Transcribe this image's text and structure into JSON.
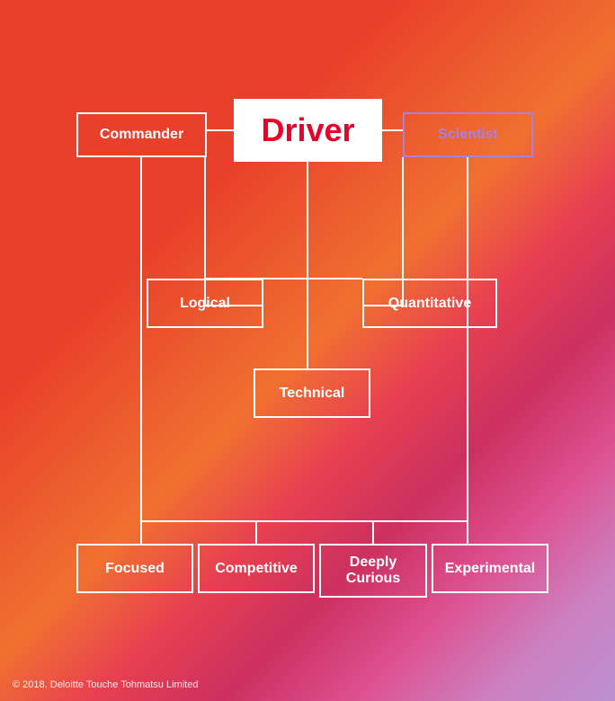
{
  "title": "Driver",
  "nodes": {
    "driver": {
      "label": "Driver"
    },
    "commander": {
      "label": "Commander"
    },
    "scientist": {
      "label": "Scientist"
    },
    "logical": {
      "label": "Logical"
    },
    "quantitative": {
      "label": "Quantitative"
    },
    "technical": {
      "label": "Technical"
    },
    "focused": {
      "label": "Focused"
    },
    "competitive": {
      "label": "Competitive"
    },
    "deeply_curious": {
      "label": "Deeply Curious"
    },
    "experimental": {
      "label": "Experimental"
    }
  },
  "footer": "© 2018. Deloitte Touche Tohmatsu Limited"
}
